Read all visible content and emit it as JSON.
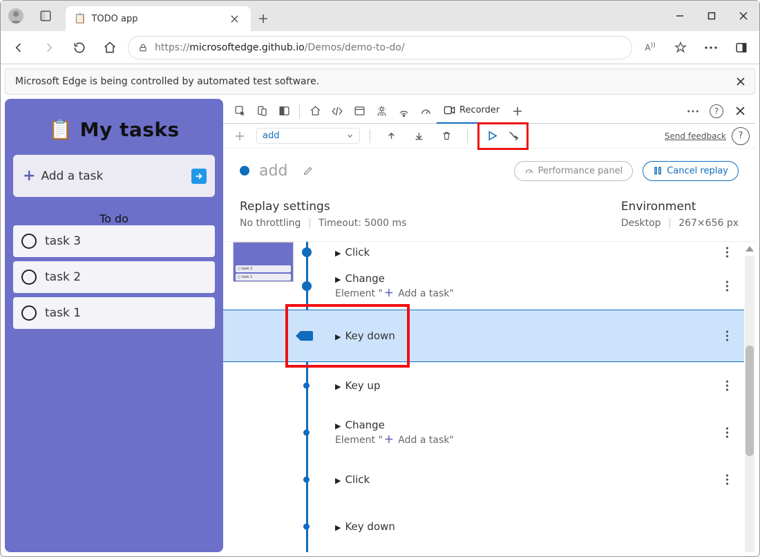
{
  "window": {
    "tab_title": "TODO app",
    "tab_icon": "📋"
  },
  "nav": {
    "url_scheme": "https://",
    "url_host": "microsoftedge.github.io",
    "url_path": "/Demos/demo-to-do/"
  },
  "infobar": {
    "text": "Microsoft Edge is being controlled by automated test software."
  },
  "app": {
    "title": "My tasks",
    "title_icon": "📋",
    "add_placeholder": "Add a task",
    "section": "To do",
    "tasks": [
      "task 3",
      "task 2",
      "task 1"
    ]
  },
  "devtools": {
    "recorder_tab": "Recorder",
    "toolbar": {
      "add_placeholder": "add",
      "feedback": "Send feedback"
    },
    "header": {
      "name": "add",
      "perf_panel": "Performance panel",
      "cancel": "Cancel replay"
    },
    "settings": {
      "title": "Replay settings",
      "throttle": "No throttling",
      "timeout": "Timeout: 5000 ms",
      "env_title": "Environment",
      "env_device": "Desktop",
      "env_size": "267×656 px"
    },
    "steps": [
      {
        "kind": "big",
        "label": "Click",
        "menu": true
      },
      {
        "kind": "big",
        "label": "Change",
        "sub_prefix": "Element \"",
        "sub_icon": "＋",
        "sub_text": " Add a task\"",
        "menu": true
      },
      {
        "kind": "highlight",
        "label": "Key down",
        "menu": true
      },
      {
        "kind": "small",
        "label": "Key up",
        "menu": true
      },
      {
        "kind": "small",
        "label": "Change",
        "sub_prefix": "Element \"",
        "sub_icon": "＋",
        "sub_text": " Add a task\"",
        "menu": true
      },
      {
        "kind": "small",
        "label": "Click",
        "menu": true
      },
      {
        "kind": "small",
        "label": "Key down",
        "menu": false
      }
    ]
  }
}
